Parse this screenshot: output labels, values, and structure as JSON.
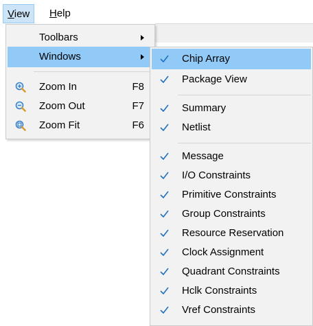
{
  "menubar": {
    "view": {
      "pre": "",
      "mnemonic": "V",
      "post": "iew"
    },
    "help": {
      "pre": "",
      "mnemonic": "H",
      "post": "elp"
    }
  },
  "view_menu": {
    "toolbars": "Toolbars",
    "windows": "Windows",
    "zoom_in": {
      "label": "Zoom In",
      "shortcut": "F8"
    },
    "zoom_out": {
      "label": "Zoom Out",
      "shortcut": "F7"
    },
    "zoom_fit": {
      "label": "Zoom Fit",
      "shortcut": "F6"
    }
  },
  "windows_menu": {
    "items": [
      {
        "label": "Chip Array",
        "checked": true
      },
      {
        "label": "Package View",
        "checked": true
      },
      {
        "label": "Summary",
        "checked": true
      },
      {
        "label": "Netlist",
        "checked": true
      },
      {
        "label": "Message",
        "checked": true
      },
      {
        "label": "I/O Constraints",
        "checked": true
      },
      {
        "label": "Primitive Constraints",
        "checked": true
      },
      {
        "label": "Group Constraints",
        "checked": true
      },
      {
        "label": "Resource Reservation",
        "checked": true
      },
      {
        "label": "Clock Assignment",
        "checked": true
      },
      {
        "label": "Quadrant Constraints",
        "checked": true
      },
      {
        "label": "Hclk Constraints",
        "checked": true
      },
      {
        "label": "Vref Constraints",
        "checked": true
      }
    ]
  },
  "colors": {
    "highlight": "#91c9f7",
    "menubar_active": "#cce4f7",
    "check": "#1f6fbf",
    "menu_bg": "#f2f2f2"
  },
  "icons": {
    "zoom_in": "magnifier-plus-icon",
    "zoom_out": "magnifier-minus-icon",
    "zoom_fit": "magnifier-fit-icon",
    "submenu": "chevron-right-icon",
    "checked": "checkmark-icon"
  }
}
